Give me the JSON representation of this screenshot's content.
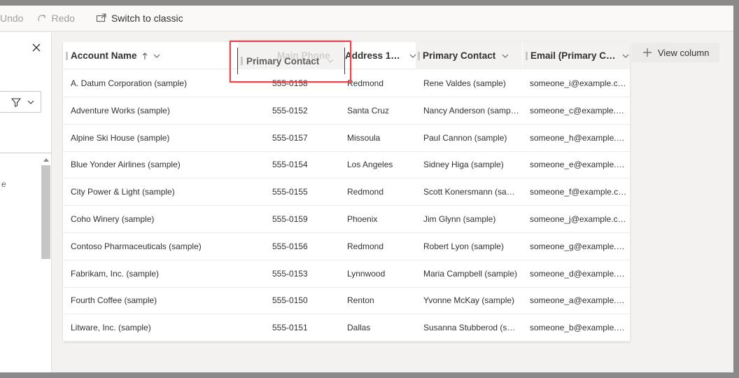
{
  "toolbar": {
    "undo_label": "Undo",
    "redo_label": "Redo",
    "switch_label": "Switch to classic"
  },
  "columns": {
    "account_name": "Account Name",
    "main_phone": "Main Phone",
    "address_city": "Address 1: ...",
    "primary_contact": "Primary Contact",
    "email": "Email (Primary Co..."
  },
  "drag_ghost_label": "Primary Contact",
  "view_column_label": "View column",
  "left_panel": {
    "fragment": "e"
  },
  "rows": [
    {
      "account": "A. Datum Corporation (sample)",
      "phone": "555-0158",
      "city": "Redmond",
      "contact": "Rene Valdes (sample)",
      "email": "someone_i@example.com"
    },
    {
      "account": "Adventure Works (sample)",
      "phone": "555-0152",
      "city": "Santa Cruz",
      "contact": "Nancy Anderson (sample)",
      "email": "someone_c@example.com"
    },
    {
      "account": "Alpine Ski House (sample)",
      "phone": "555-0157",
      "city": "Missoula",
      "contact": "Paul Cannon (sample)",
      "email": "someone_h@example.com"
    },
    {
      "account": "Blue Yonder Airlines (sample)",
      "phone": "555-0154",
      "city": "Los Angeles",
      "contact": "Sidney Higa (sample)",
      "email": "someone_e@example.com"
    },
    {
      "account": "City Power & Light (sample)",
      "phone": "555-0155",
      "city": "Redmond",
      "contact": "Scott Konersmann (sample)",
      "email": "someone_f@example.com"
    },
    {
      "account": "Coho Winery (sample)",
      "phone": "555-0159",
      "city": "Phoenix",
      "contact": "Jim Glynn (sample)",
      "email": "someone_j@example.com"
    },
    {
      "account": "Contoso Pharmaceuticals (sample)",
      "phone": "555-0156",
      "city": "Redmond",
      "contact": "Robert Lyon (sample)",
      "email": "someone_g@example.com"
    },
    {
      "account": "Fabrikam, Inc. (sample)",
      "phone": "555-0153",
      "city": "Lynnwood",
      "contact": "Maria Campbell (sample)",
      "email": "someone_d@example.com"
    },
    {
      "account": "Fourth Coffee (sample)",
      "phone": "555-0150",
      "city": "Renton",
      "contact": "Yvonne McKay (sample)",
      "email": "someone_a@example.com"
    },
    {
      "account": "Litware, Inc. (sample)",
      "phone": "555-0151",
      "city": "Dallas",
      "contact": "Susanna Stubberod (sample)",
      "email": "someone_b@example.com"
    }
  ]
}
